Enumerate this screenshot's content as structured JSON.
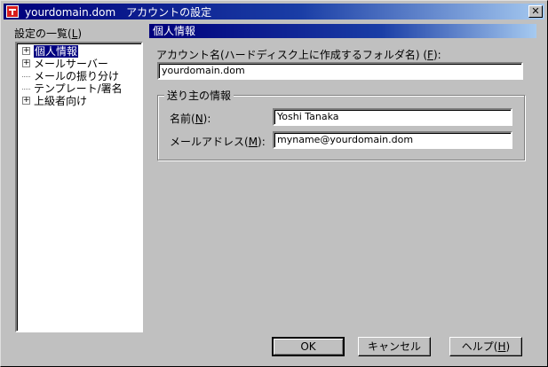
{
  "window": {
    "title": "yourdomain.dom　アカウントの設定",
    "close_glyph": "✕"
  },
  "sidebar": {
    "label": "設定の一覧(",
    "label_mnemonic": "L",
    "label_suffix": ")",
    "items": [
      {
        "label": "個人情報",
        "expander": "+",
        "selected": true
      },
      {
        "label": "メールサーバー",
        "expander": "+"
      },
      {
        "label": "メールの振り分け",
        "expander": ""
      },
      {
        "label": "テンプレート/署名",
        "expander": ""
      },
      {
        "label": "上級者向け",
        "expander": "+"
      }
    ]
  },
  "panel": {
    "title": "個人情報",
    "account_label": "アカウント名(ハードディスク上に作成するフォルダ名) (",
    "account_mnemonic": "F",
    "account_suffix": "):",
    "account_value": "yourdomain.dom",
    "sender_group_title": "送り主の情報",
    "name_label": "名前(",
    "name_mnemonic": "N",
    "name_suffix": "):",
    "name_value": "Yoshi Tanaka",
    "email_label": "メールアドレス(",
    "email_mnemonic": "M",
    "email_suffix": "):",
    "email_value": "myname@yourdomain.dom"
  },
  "buttons": {
    "ok": "OK",
    "cancel": "キャンセル",
    "help": "ヘルプ(",
    "help_mnemonic": "H",
    "help_suffix": ")"
  },
  "colors": {
    "titlebar": "#00007b",
    "face": "#c0c0c0",
    "selection": "#000080"
  }
}
